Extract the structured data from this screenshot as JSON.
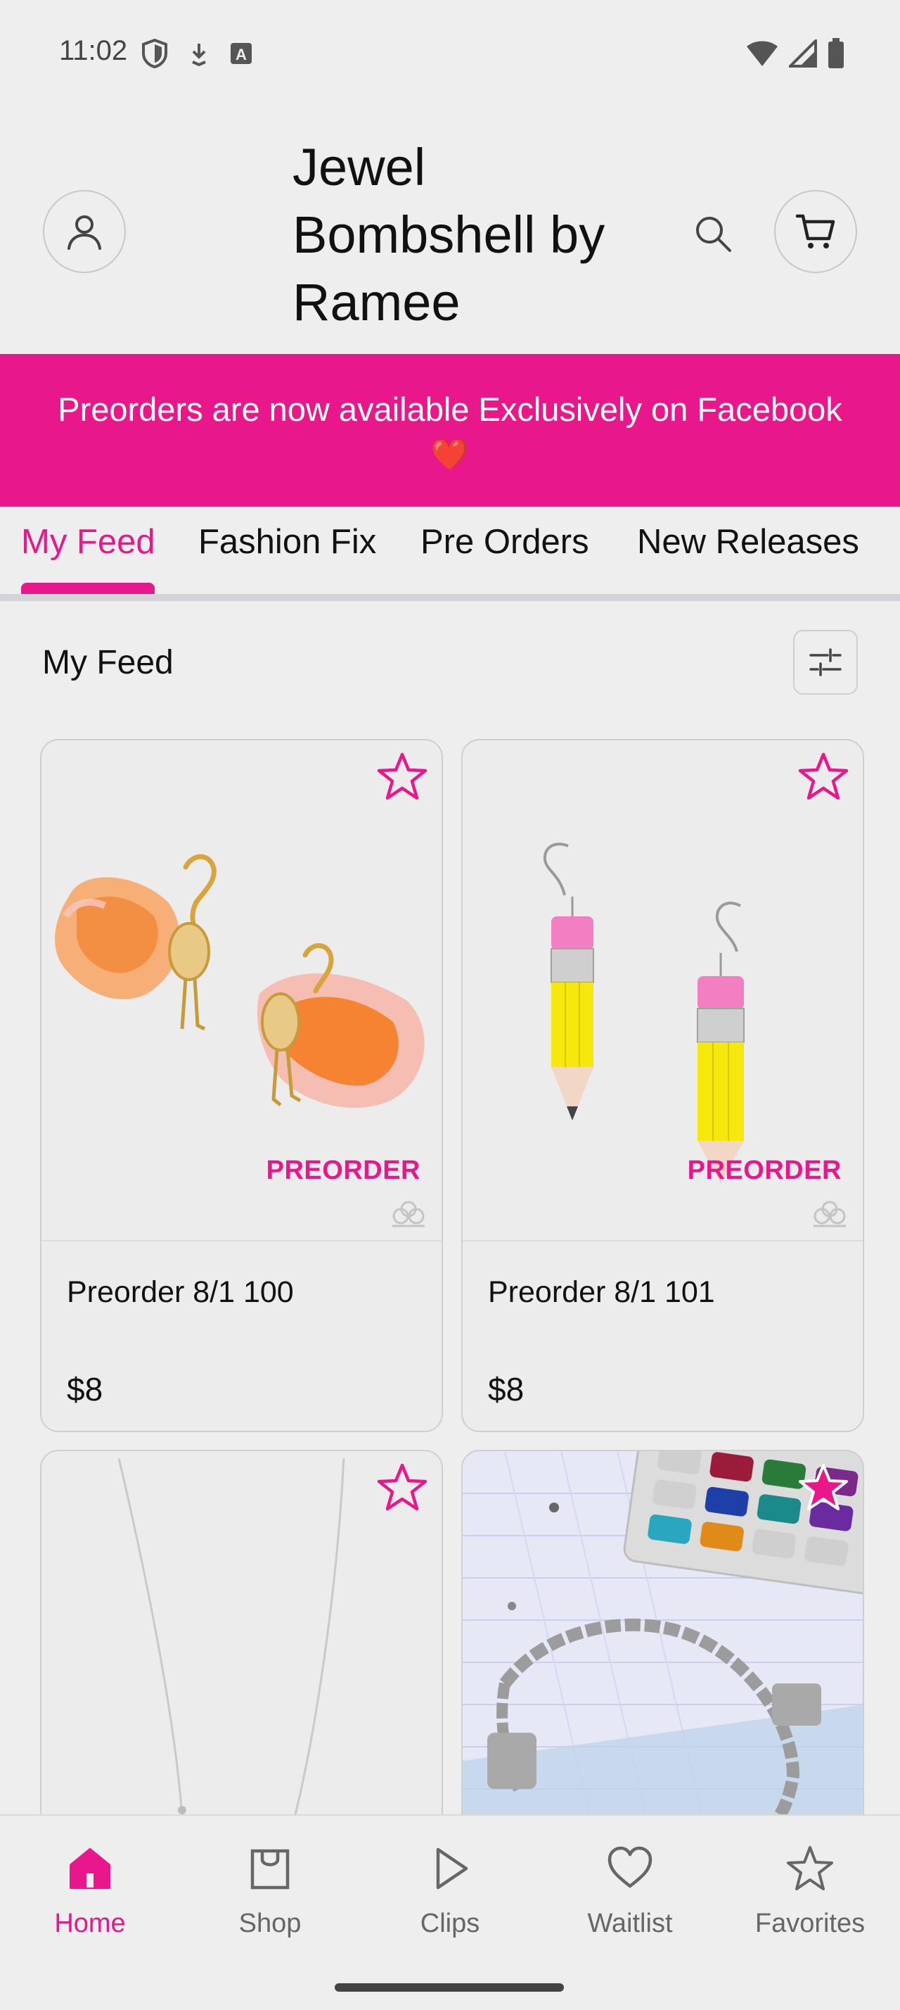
{
  "status_bar": {
    "time": "11:02",
    "icons_left": [
      "shield-icon",
      "download-icon",
      "keyboard-a-icon"
    ],
    "icons_right": [
      "wifi-icon",
      "signal-icon",
      "battery-icon"
    ]
  },
  "header": {
    "title": "Jewel Bombshell by Ramee",
    "profile_icon": "user-icon",
    "search_icon": "search-icon",
    "cart_icon": "cart-icon"
  },
  "banner": {
    "text": "Preorders are now available Exclusively on Facebook",
    "emoji": "❤️"
  },
  "tabs": [
    {
      "label": "My Feed",
      "active": true
    },
    {
      "label": "Fashion Fix",
      "active": false
    },
    {
      "label": "Pre Orders",
      "active": false
    },
    {
      "label": "New Releases",
      "active": false
    }
  ],
  "feed": {
    "title": "My Feed",
    "filter_icon": "sliders-icon"
  },
  "products": [
    {
      "name": "Preorder 8/1 100",
      "price": "$8",
      "tag": "PREORDER",
      "image": "flamingo-earrings"
    },
    {
      "name": "Preorder 8/1 101",
      "price": "$8",
      "tag": "PREORDER",
      "image": "pencil-earrings"
    },
    {
      "name": "",
      "price": "",
      "tag": "",
      "image": "silver-necklace"
    },
    {
      "name": "",
      "price": "",
      "tag": "",
      "image": "charm-bracelet"
    }
  ],
  "bottom_nav": [
    {
      "label": "Home",
      "icon": "home-icon",
      "active": true
    },
    {
      "label": "Shop",
      "icon": "bag-icon",
      "active": false
    },
    {
      "label": "Clips",
      "icon": "play-icon",
      "active": false
    },
    {
      "label": "Waitlist",
      "icon": "heart-icon",
      "active": false
    },
    {
      "label": "Favorites",
      "icon": "star-icon",
      "active": false
    }
  ],
  "colors": {
    "accent": "#e8178a",
    "background": "#eeeeee",
    "text": "#111111",
    "muted": "#666666"
  }
}
